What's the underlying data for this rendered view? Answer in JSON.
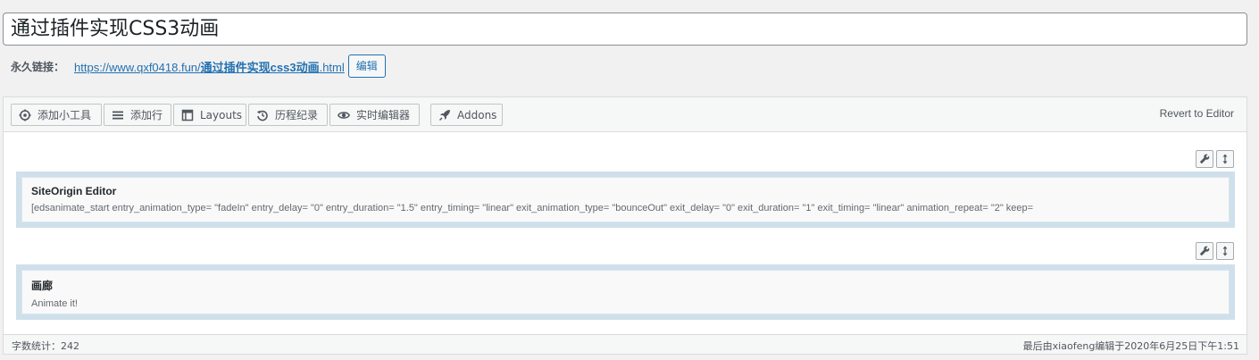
{
  "post": {
    "title": "通过插件实现CSS3动画"
  },
  "permalink": {
    "label": "永久链接：",
    "base_url": "https://www.qxf0418.fun/",
    "slug": "通过插件实现css3动画",
    "suffix": ".html",
    "edit_label": "编辑"
  },
  "toolbar": {
    "buttons": [
      {
        "label": "添加小工具",
        "icon": "gear-icon"
      },
      {
        "label": "添加行",
        "icon": "menu-lines-icon"
      },
      {
        "label": "Layouts",
        "icon": "layout-icon"
      },
      {
        "label": "历程纪录",
        "icon": "history-icon"
      },
      {
        "label": "实时编辑器",
        "icon": "eye-icon"
      },
      {
        "label": "Addons",
        "icon": "rocket-icon"
      }
    ],
    "revert_label": "Revert to Editor"
  },
  "rows": [
    {
      "widget_title": "SiteOrigin Editor",
      "widget_desc": "[edsanimate_start entry_animation_type= \"fadeIn\" entry_delay= \"0\" entry_duration= \"1.5\" entry_timing= \"linear\" exit_animation_type= \"bounceOut\" exit_delay= \"0\" exit_duration= \"1\" exit_timing= \"linear\" animation_repeat= \"2\" keep="
    },
    {
      "widget_title": "画廊",
      "widget_desc": "Animate it!"
    }
  ],
  "status": {
    "word_count": "字数统计：242",
    "last_modified": "最后由xiaofeng编辑于2020年6月25日下午1:51"
  }
}
